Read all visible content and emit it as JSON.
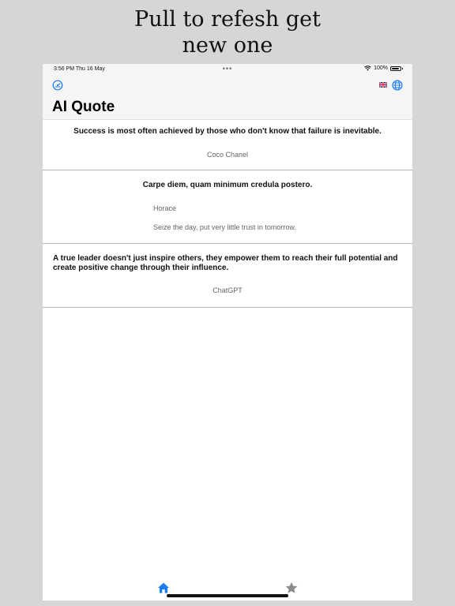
{
  "promo": {
    "line1": "Pull to refesh get",
    "line2": "new one"
  },
  "status_bar": {
    "time": "3:56 PM   Thu 16 May",
    "dots": "•••",
    "battery": "100%"
  },
  "nav": {
    "title": "AI Quote",
    "settings_icon": "settings-gauge-icon",
    "flag_icon": "uk-flag-icon",
    "globe_icon": "globe-icon"
  },
  "quotes": [
    {
      "text": "Success is most often achieved by those who don't know that failure is inevitable.",
      "author": "Coco Chanel",
      "translation": ""
    },
    {
      "text": "Carpe diem, quam minimum credula postero.",
      "author": "Horace",
      "translation": "Seize the day, put very little trust in tomorrow."
    },
    {
      "text": "A true leader doesn't just inspire others, they empower them to reach their full potential and create positive change through their influence.",
      "author": "ChatGPT",
      "translation": ""
    }
  ],
  "tabs": [
    {
      "name": "home",
      "icon": "house-icon",
      "active": true
    },
    {
      "name": "favorites",
      "icon": "star-icon",
      "active": false
    }
  ],
  "colors": {
    "accent": "#1a7cf2",
    "inactive": "#8a8a8a",
    "background": "#d6d6d6"
  }
}
